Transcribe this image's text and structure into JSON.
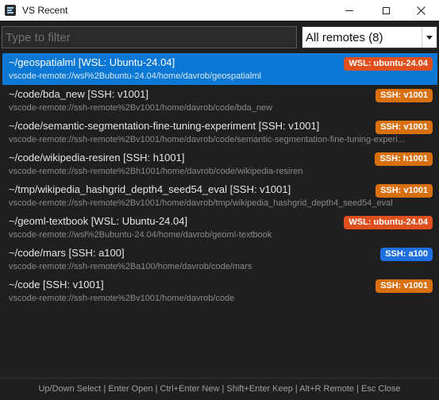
{
  "window": {
    "title": "VS Recent",
    "icon": "app-icon"
  },
  "filter": {
    "placeholder": "Type to filter",
    "value": ""
  },
  "remote_select": {
    "value": "All remotes (8)"
  },
  "colors": {
    "wsl_badge": "#e0501f",
    "ssh_badge": "#d9700f",
    "ssh_a100_badge": "#1e6fe0",
    "selected_row": "#0a78d4"
  },
  "items": [
    {
      "title": "~/geospatialml [WSL: Ubuntu-24.04]",
      "path": "vscode-remote://wsl%2Bubuntu-24.04/home/davrob/geospatialml",
      "badge": "WSL: ubuntu-24.04",
      "badge_color": "#e0501f",
      "selected": true
    },
    {
      "title": "~/code/bda_new [SSH: v1001]",
      "path": "vscode-remote://ssh-remote%2Bv1001/home/davrob/code/bda_new",
      "badge": "SSH: v1001",
      "badge_color": "#d9700f",
      "selected": false
    },
    {
      "title": "~/code/semantic-segmentation-fine-tuning-experiment [SSH: v1001]",
      "path": "vscode-remote://ssh-remote%2Bv1001/home/davrob/code/semantic-segmentation-fine-tuning-experi...",
      "badge": "SSH: v1001",
      "badge_color": "#d9700f",
      "selected": false
    },
    {
      "title": "~/code/wikipedia-resiren [SSH: h1001]",
      "path": "vscode-remote://ssh-remote%2Bh1001/home/davrob/code/wikipedia-resiren",
      "badge": "SSH: h1001",
      "badge_color": "#d9700f",
      "selected": false
    },
    {
      "title": "~/tmp/wikipedia_hashgrid_depth4_seed54_eval [SSH: v1001]",
      "path": "vscode-remote://ssh-remote%2Bv1001/home/davrob/tmp/wikipedia_hashgrid_depth4_seed54_eval",
      "badge": "SSH: v1001",
      "badge_color": "#d9700f",
      "selected": false
    },
    {
      "title": "~/geoml-textbook [WSL: Ubuntu-24.04]",
      "path": "vscode-remote://wsl%2Bubuntu-24.04/home/davrob/geoml-textbook",
      "badge": "WSL: ubuntu-24.04",
      "badge_color": "#e0501f",
      "selected": false
    },
    {
      "title": "~/code/mars [SSH: a100]",
      "path": "vscode-remote://ssh-remote%2Ba100/home/davrob/code/mars",
      "badge": "SSH: a100",
      "badge_color": "#1e6fe0",
      "selected": false
    },
    {
      "title": "~/code [SSH: v1001]",
      "path": "vscode-remote://ssh-remote%2Bv1001/home/davrob/code",
      "badge": "SSH: v1001",
      "badge_color": "#d9700f",
      "selected": false
    }
  ],
  "footer": {
    "shortcuts": "Up/Down Select | Enter Open | Ctrl+Enter New | Shift+Enter Keep | Alt+R Remote | Esc Close"
  }
}
